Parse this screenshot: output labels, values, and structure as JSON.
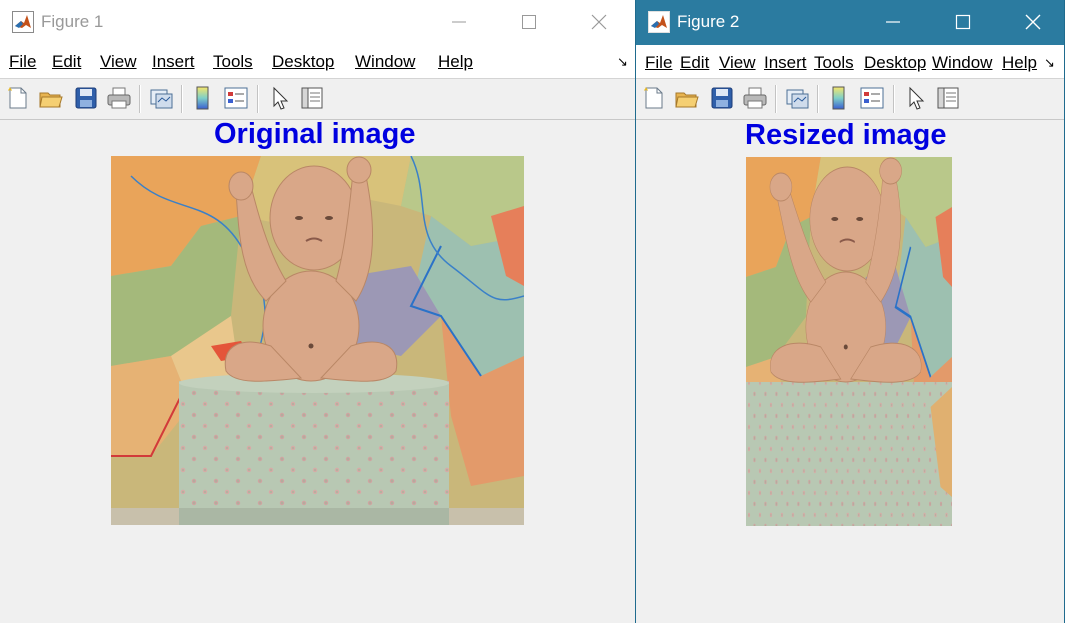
{
  "figure1": {
    "title": "Figure 1",
    "menu": [
      "File",
      "Edit",
      "View",
      "Insert",
      "Tools",
      "Desktop",
      "Window",
      "Help"
    ],
    "dock_arrow": "↘",
    "axes_title": "Original image"
  },
  "figure2": {
    "title": "Figure 2",
    "menu": [
      "File",
      "Edit",
      "View",
      "Insert",
      "Tools",
      "Desktop",
      "Window",
      "Help"
    ],
    "dock_arrow": "↘",
    "axes_title": "Resized image"
  },
  "icons": {
    "app": "matlab-logo-icon",
    "toolbar": [
      "new-figure-icon",
      "open-file-icon",
      "save-icon",
      "print-icon",
      "link-plot-icon",
      "insert-colorbar-icon",
      "insert-legend-icon",
      "edit-plot-pointer-icon",
      "property-inspector-icon"
    ]
  },
  "colors": {
    "title_blue": "#0000e0",
    "active_titlebar": "#2b7ba0",
    "map_orange": "#e8a45a",
    "map_green": "#9cb97a",
    "box_green": "#b9c9b4",
    "skin": "#d9a788"
  }
}
